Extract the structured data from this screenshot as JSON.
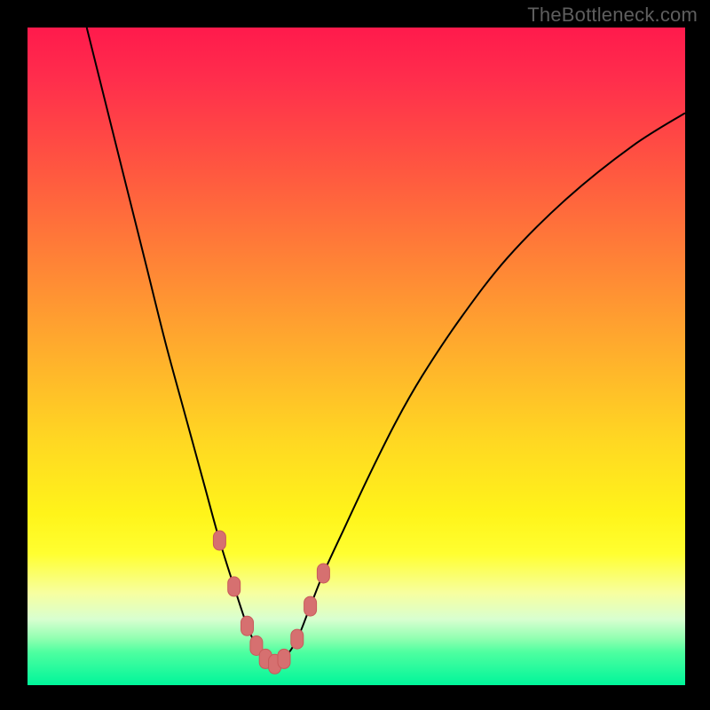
{
  "watermark": "TheBottleneck.com",
  "chart_data": {
    "type": "line",
    "title": "",
    "xlabel": "",
    "ylabel": "",
    "xlim": [
      0,
      100
    ],
    "ylim": [
      0,
      100
    ],
    "grid": false,
    "legend": false,
    "series": [
      {
        "name": "bottleneck-curve",
        "x": [
          9,
          12,
          15,
          18,
          21,
          24,
          27,
          29.2,
          31.4,
          33.4,
          34.8,
          36.2,
          37.6,
          39,
          41,
          43,
          45,
          48,
          52,
          56,
          60,
          66,
          73,
          82,
          92,
          100
        ],
        "values": [
          100,
          88,
          76,
          64,
          52,
          41,
          30,
          22,
          15,
          9,
          6,
          4,
          3.2,
          4,
          7,
          12,
          17,
          23.5,
          32,
          40,
          47,
          56,
          65,
          74,
          82,
          87
        ]
      }
    ],
    "markers": {
      "name": "sample-points",
      "x": [
        29.2,
        31.4,
        33.4,
        34.8,
        36.2,
        37.6,
        39,
        41,
        43,
        45
      ],
      "values": [
        22,
        15,
        9,
        6,
        4,
        3.2,
        4,
        7,
        12,
        17
      ]
    },
    "background": {
      "type": "vertical-gradient",
      "stops": [
        {
          "pos": 0,
          "color": "#ff1a4c"
        },
        {
          "pos": 0.5,
          "color": "#ffb02c"
        },
        {
          "pos": 0.8,
          "color": "#ffff30"
        },
        {
          "pos": 1.0,
          "color": "#00f59a"
        }
      ]
    }
  }
}
